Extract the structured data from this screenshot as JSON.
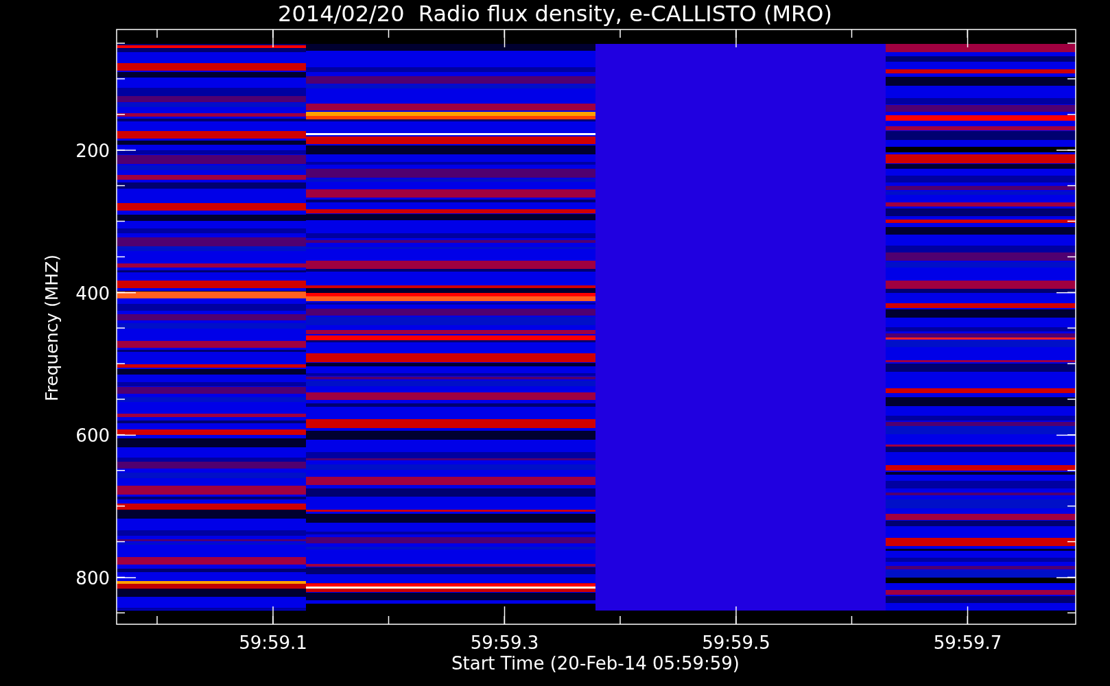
{
  "title": "2014/02/20  Radio flux density, e-CALLISTO (MRO)",
  "y_axis": {
    "label": "Frequency (MHZ)",
    "ticks": [
      "200",
      "400",
      "600",
      "800"
    ]
  },
  "x_axis": {
    "label": "Start Time (20-Feb-14 05:59:59)",
    "ticks": [
      "59:59.1",
      "59:59.3",
      "59:59.5",
      "59:59.7"
    ]
  }
}
